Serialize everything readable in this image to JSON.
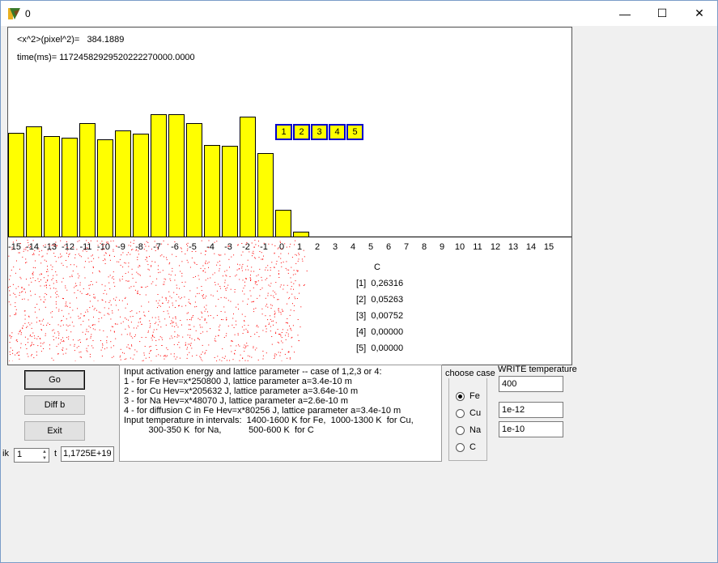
{
  "window": {
    "title": "0",
    "controls": {
      "minimize": "—",
      "maximize": "☐",
      "close": "✕"
    }
  },
  "canvas": {
    "msd_line": "<x^2>(pixel^2)=   384.1889",
    "time_line": "time(ms)= 11724582929520222270000.0000",
    "legend": [
      "1",
      "2",
      "3",
      "4",
      "5"
    ],
    "conc_header": "C",
    "concentrations": [
      {
        "label": "[1]",
        "value": "0,26316"
      },
      {
        "label": "[2]",
        "value": "0,05263"
      },
      {
        "label": "[3]",
        "value": "0,00752"
      },
      {
        "label": "[4]",
        "value": "0,00000"
      },
      {
        "label": "[5]",
        "value": "0,00000"
      }
    ]
  },
  "chart_data": {
    "type": "bar",
    "categories": [
      "-15",
      "-14",
      "-13",
      "-12",
      "-11",
      "-10",
      "-9",
      "-8",
      "-7",
      "-6",
      "-5",
      "-4",
      "-3",
      "-2",
      "-1",
      "0",
      "1",
      "2",
      "3",
      "4",
      "5",
      "6",
      "7",
      "8",
      "9",
      "10",
      "11",
      "12",
      "13",
      "14",
      "15"
    ],
    "x_tick_labels": [
      "-15",
      "-14",
      "-13",
      "-12",
      "-11",
      "-10",
      "-9",
      "-8",
      "-7",
      "-6",
      "-5",
      "-4",
      "-3",
      "-2",
      "-1",
      "0",
      "1",
      "2",
      "3",
      "4",
      "5",
      "6",
      "7",
      "8",
      "9",
      "10",
      "11",
      "12",
      "13",
      "14",
      "15"
    ],
    "values": [
      128,
      136,
      124,
      122,
      140,
      120,
      131,
      127,
      151,
      151,
      140,
      113,
      112,
      148,
      103,
      33,
      6,
      0,
      0,
      0,
      0,
      0,
      0,
      0,
      0,
      0,
      0,
      0,
      0,
      0,
      0
    ],
    "ylim": [
      0,
      250
    ],
    "bar_color": "#ffff00",
    "grid": false
  },
  "buttons": {
    "go": "Go",
    "diff": "Diff b",
    "exit": "Exit"
  },
  "info_text": "Input activation energy and lattice parameter -- case of 1,2,3 or 4:\n1 - for Fe Hev=x*250800 J, lattice parameter a=3.4e-10 m\n2 - for Cu Hev=x*205632 J, lattice parameter a=3.64e-10 m\n3 - for Na Hev=x*48070 J, lattice parameter a=2.6e-10 m\n4 - for diffusion C in Fe Hev=x*80256 J, lattice parameter a=3.4e-10 m\nInput temperature in intervals:  1400-1600 K for Fe,  1000-1300 K  for Cu,\n          300-350 K  for Na,           500-600 K  for C",
  "choose_case": {
    "label": "choose case",
    "options": [
      "Fe",
      "Cu",
      "Na",
      "C"
    ],
    "selected": "Fe"
  },
  "write": {
    "label": "WRITE temperature",
    "temperature": "400",
    "field2": "1e-12",
    "field3": "1e-10"
  },
  "bottom": {
    "ik_label": "ik",
    "ik_value": "1",
    "t_label": "t",
    "t_value": "1,1725E+19"
  },
  "colors": {
    "accent": "#0000cc",
    "dots": "#ff0000"
  }
}
